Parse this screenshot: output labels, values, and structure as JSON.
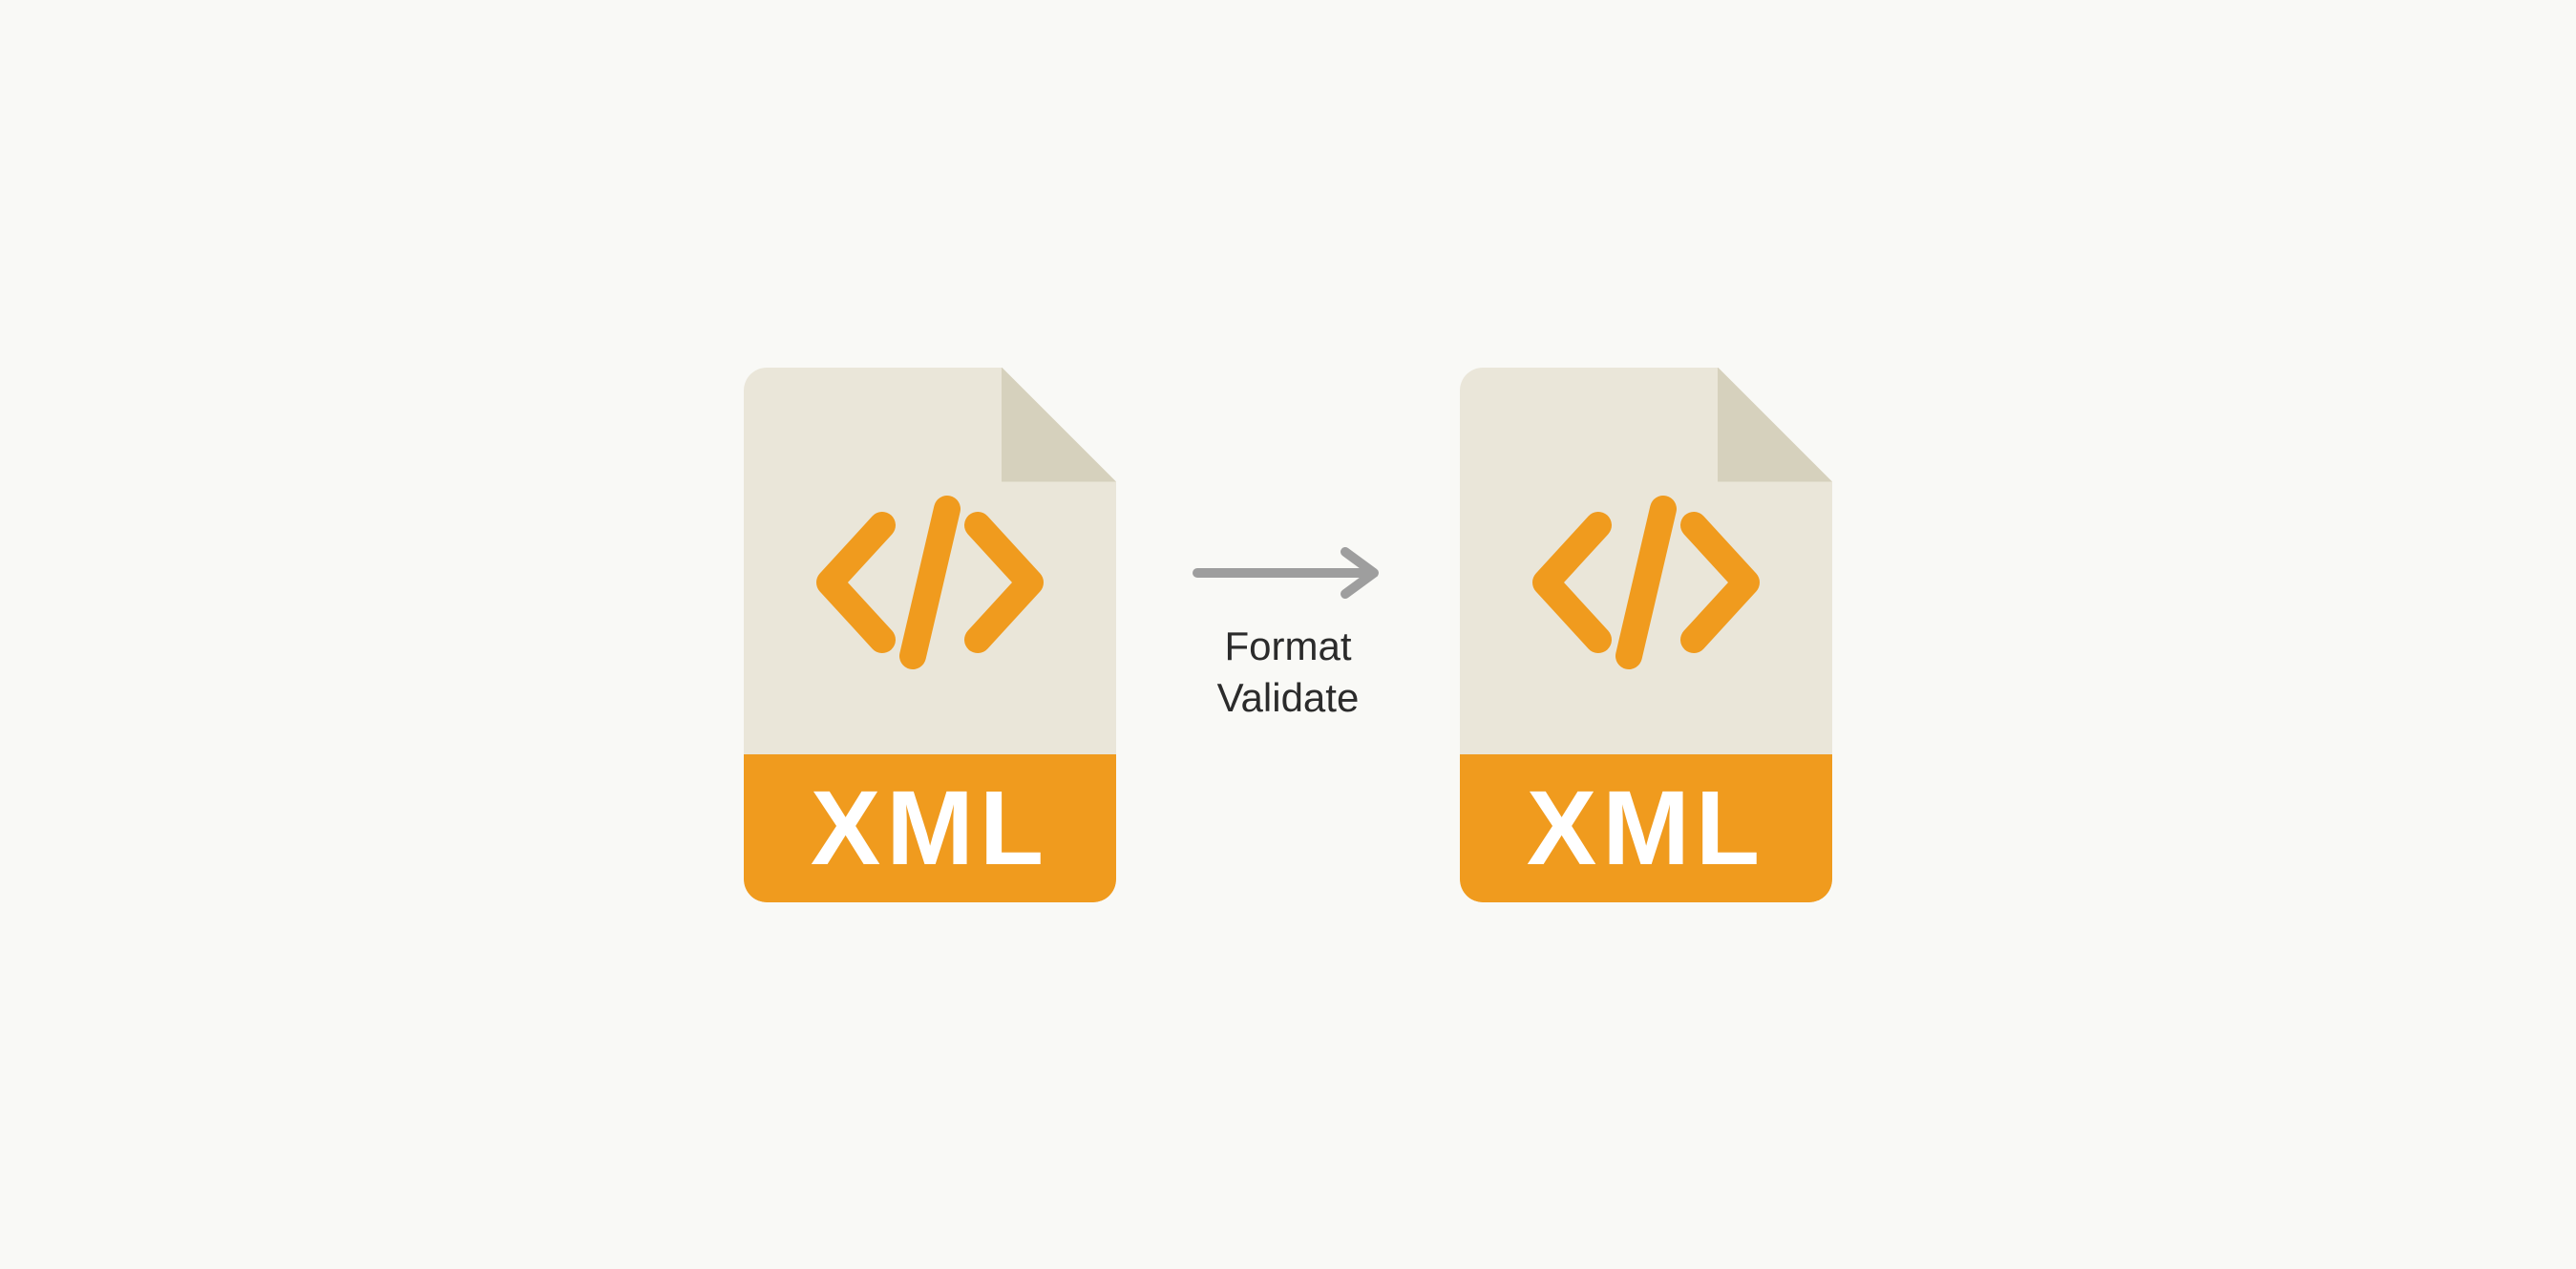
{
  "left_file": {
    "extension_label": "XML"
  },
  "right_file": {
    "extension_label": "XML"
  },
  "action": {
    "line1": "Format",
    "line2": "Validate"
  },
  "colors": {
    "accent": "#f09b1e",
    "paper": "#eae6d9",
    "fold": "#d6d1bd",
    "bg": "#f9f9f6",
    "arrow": "#9e9e9e"
  }
}
